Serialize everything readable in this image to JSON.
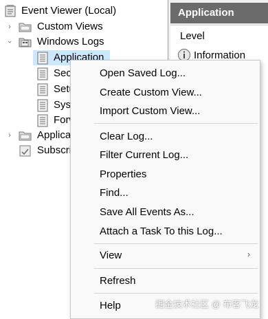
{
  "tree": {
    "root_label": "Event Viewer (Local)",
    "custom_views_label": "Custom Views",
    "windows_logs_label": "Windows Logs",
    "logs": [
      {
        "label": "Application"
      },
      {
        "label": "Secu"
      },
      {
        "label": "Setu"
      },
      {
        "label": "Syst"
      },
      {
        "label": "Forw"
      }
    ],
    "applications_label": "Applica",
    "subscriptions_label": "Subscri"
  },
  "right_pane": {
    "header": "Application",
    "column_header": "Level",
    "first_level": "Information"
  },
  "context_menu": {
    "items": [
      {
        "label": "Open Saved Log..."
      },
      {
        "label": "Create Custom View..."
      },
      {
        "label": "Import Custom View..."
      },
      {
        "label": "Clear Log..."
      },
      {
        "label": "Filter Current Log..."
      },
      {
        "label": "Properties"
      },
      {
        "label": "Find..."
      },
      {
        "label": "Save All Events As..."
      },
      {
        "label": "Attach a Task To this Log..."
      },
      {
        "label": "View"
      },
      {
        "label": "Refresh"
      },
      {
        "label": "Help"
      }
    ],
    "submenu_arrow": "›"
  },
  "watermark": "掘金技术社区 @ 布客飞龙",
  "colors": {
    "selection": "#cce8ff",
    "header_bg": "#6b6b6b",
    "menu_bg": "#f9f9f9"
  }
}
